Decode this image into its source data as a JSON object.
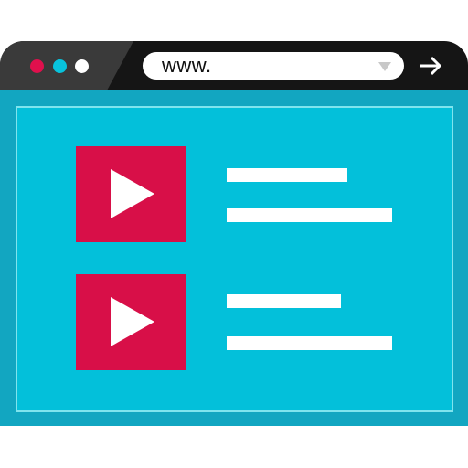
{
  "colors": {
    "titlebar": "#151515",
    "titlebar_shade": "#3a3a3a",
    "viewport_outer": "#12a6c1",
    "viewport_inner": "#03c0da",
    "frame_border": "#7fe4ee",
    "thumbnail": "#d80f48",
    "dot_red": "#e0104d",
    "dot_cyan": "#08c3dc",
    "dot_white": "#ffffff"
  },
  "browser": {
    "address_bar": {
      "value": "www."
    },
    "icons": {
      "dropdown": "chevron-down-icon",
      "go": "arrow-right-icon"
    }
  },
  "content": {
    "videos": [
      {
        "icon": "play-icon",
        "text_lines": 2
      },
      {
        "icon": "play-icon",
        "text_lines": 2
      }
    ]
  }
}
